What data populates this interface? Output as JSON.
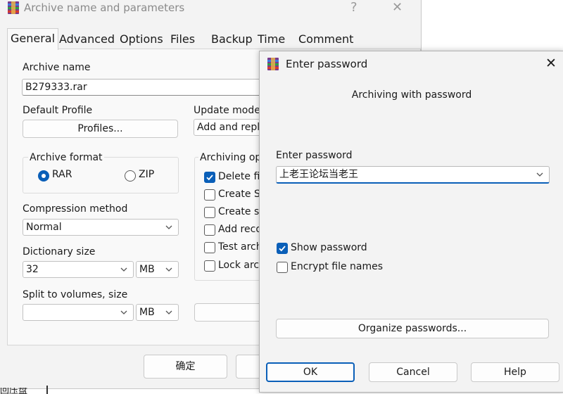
{
  "window": {
    "title": "Archive name and parameters",
    "help_glyph": "?",
    "close_glyph": "✕"
  },
  "tabs": [
    "General",
    "Advanced",
    "Options",
    "Files",
    "Backup",
    "Time",
    "Comment"
  ],
  "general": {
    "archive_name_label": "Archive name",
    "archive_name_value": "B279333.rar",
    "default_profile_label": "Default Profile",
    "profiles_button": "Profiles...",
    "update_mode_label": "Update mode",
    "update_mode_value": "Add and repla",
    "archive_format_label": "Archive format",
    "format_rar": "RAR",
    "format_zip": "ZIP",
    "archiving_options_label": "Archiving opt",
    "options": [
      "Delete fil",
      "Create SF",
      "Create so",
      "Add reco",
      "Test arch",
      "Lock arch"
    ],
    "compression_label": "Compression method",
    "compression_value": "Normal",
    "dictionary_label": "Dictionary size",
    "dictionary_value": "32",
    "dictionary_unit": "MB",
    "split_label": "Split to volumes, size",
    "split_value": "",
    "split_unit": "MB"
  },
  "footer": {
    "ok_label": "确定"
  },
  "bottom_fragment": "回压盘",
  "dialog": {
    "title": "Enter password",
    "close_glyph": "✕",
    "heading": "Archiving with password",
    "password_label": "Enter password",
    "password_value": "上老王论坛当老王",
    "show_password_label": "Show password",
    "encrypt_names_label": "Encrypt file names",
    "organize_button": "Organize passwords...",
    "ok_button": "OK",
    "cancel_button": "Cancel",
    "help_button": "Help"
  },
  "colors": {
    "accent": "#0a5fb8"
  }
}
